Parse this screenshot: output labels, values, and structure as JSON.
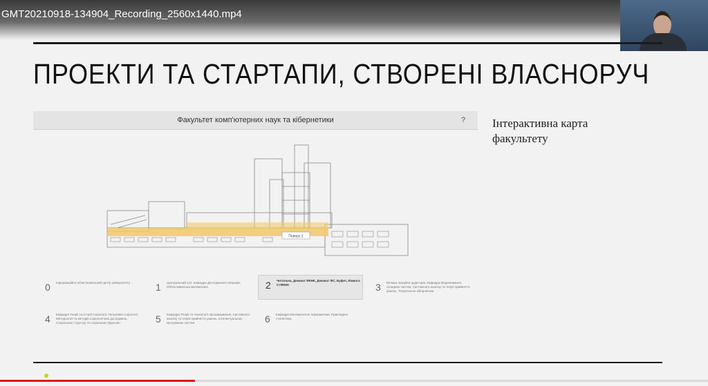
{
  "video": {
    "filename": "GMT20210918-134904_Recording_2560x1440.mp4",
    "progress": 0.275
  },
  "slide": {
    "title": "ПРОЕКТИ ТА СТАРТАПИ, СТВОРЕНІ ВЛАСНОРУЧ",
    "caption": "Інтерактивна карта факультету"
  },
  "map": {
    "header_title": "Факультет комп'ютерних наук та кібернетики",
    "help_label": "?",
    "floor_tag": "Поверх 2",
    "floors": [
      {
        "number": "0",
        "description": "Інформаційно-обчислювальний центр університету"
      },
      {
        "number": "1",
        "description": "Центральний хол, Кафедра Дослідження операцій, Обчислювальна математика"
      },
      {
        "number": "2",
        "description": "Читальна, Деканат ФКНК, Деканат ФС, Буфет, Кімната СтФКНК"
      },
      {
        "number": "3",
        "description": "Велика лекційна аудиторія, Кафедра Моделювання складних систем, Системного аналізу та теорії прийняття рішень, Теоретичної кібернетики"
      },
      {
        "number": "4",
        "description": "Кафедра Теорії та історії соціології, Галузевих соціології, Методології та методів соціологічних досліджень, Соціальних структур та соціальних відносин"
      },
      {
        "number": "5",
        "description": "Кафедра Теорії та технології програмування, Системного аналізу та теорії прийняття рішень, Інтелектуальних програмних систем"
      },
      {
        "number": "6",
        "description": "Кафедра Математичної інформатики, Прикладної статистики"
      }
    ],
    "active_floor": 2
  }
}
